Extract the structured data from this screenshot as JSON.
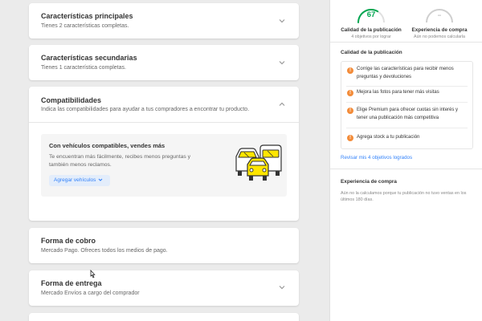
{
  "left": {
    "cards": {
      "principales": {
        "title": "Características principales",
        "subtitle": "Tienes 2 características completas."
      },
      "secundarias": {
        "title": "Características secundarias",
        "subtitle": "Tienes 1 característica completas."
      },
      "compatibilidades": {
        "title": "Compatibilidades",
        "subtitle": "Indica las compatibilidades para ayudar a tus compradores a encontrar tu producto.",
        "box_title": "Con vehículos compatibles, vendes más",
        "box_text": "Te encuentran más fácilmente, recibes menos preguntas y también menos reclamos.",
        "button_label": "Agregar vehículos"
      },
      "cobro": {
        "title": "Forma de cobro",
        "subtitle": "Mercado Pago. Ofreces todos los medios de pago."
      },
      "entrega": {
        "title": "Forma de entrega",
        "subtitle": "Mercado Envíos a cargo del comprador"
      }
    }
  },
  "right": {
    "quality": {
      "value": "67",
      "value_fraction": 0.67,
      "label": "Calidad de la publicación",
      "sub": "4 objetivos por lograr",
      "color": "#00a650"
    },
    "experience": {
      "value": "--",
      "label": "Experiencia de compra",
      "sub": "Aún no podemos calcularla"
    },
    "quality_section_title": "Calidad de la publicación",
    "recommendations": [
      "Corrige las características para recibir menos preguntas y devoluciones",
      "Mejora las fotos para tener más visitas",
      "Elige Premium para ofrecer cuotas sin interés y tener una publicación más competitiva",
      "Agrega stock a tu publicación"
    ],
    "reachieved_link": "Revisar mis 4 objetivos logrados",
    "experience_section_title": "Experiencia de compra",
    "experience_desc": "Aún no la calculamos porque tu publicación no tuvo ventas en los últimos 180 días."
  },
  "colors": {
    "accent": "#3483fa",
    "warning": "#f38c3a",
    "car_yellow": "#ffe600"
  }
}
